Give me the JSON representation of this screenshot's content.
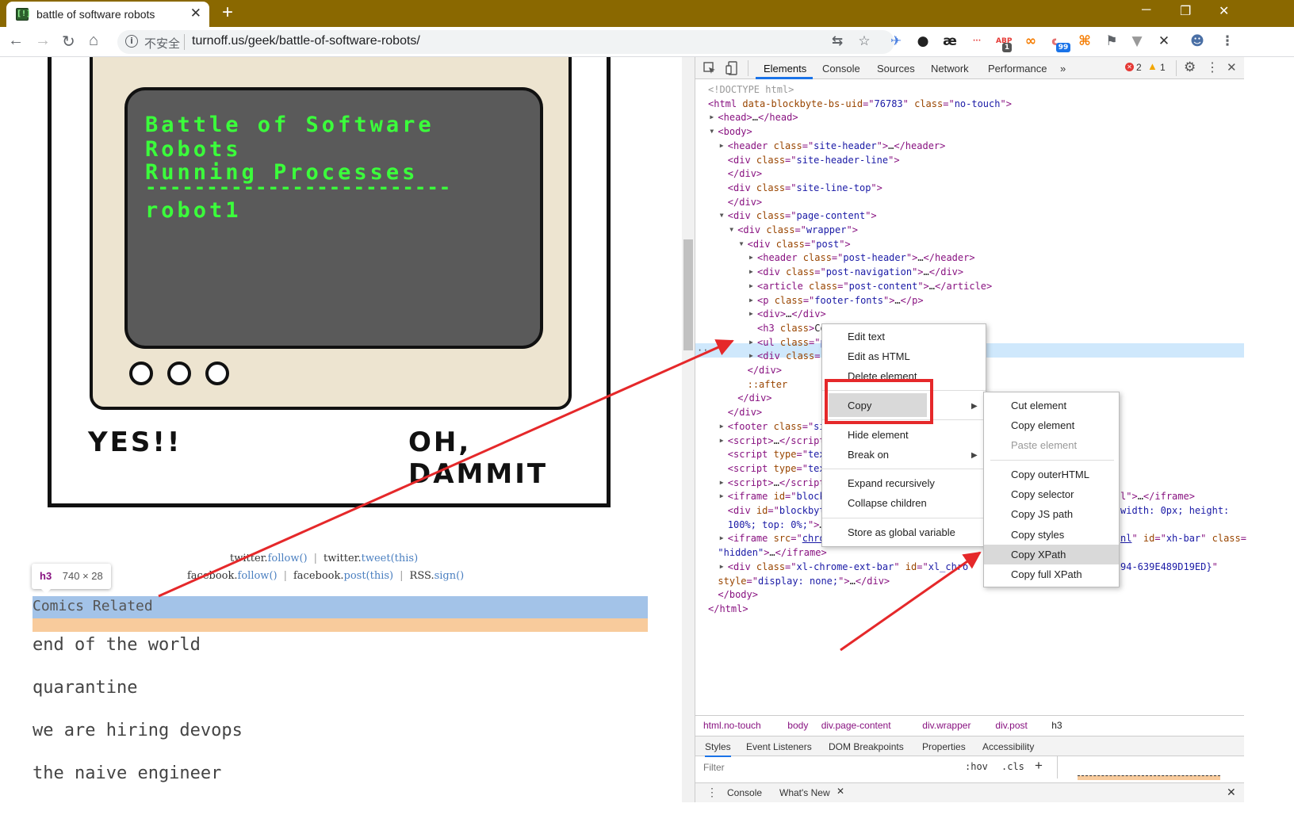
{
  "browser": {
    "tab_title": "battle of software robots",
    "tab_favicon": "[!]",
    "new_tab": "+",
    "minimize": "─",
    "restore": "❐",
    "close": "✕",
    "back": "←",
    "forward": "→",
    "reload": "↻",
    "home": "⌂",
    "info_icon": "i",
    "security_label": "不安全",
    "url": "turnoff.us/geek/battle-of-software-robots/",
    "extensions": [
      {
        "icon": "translate-icon",
        "glyph": "⇆",
        "color": "#5f6368"
      },
      {
        "icon": "star-icon",
        "glyph": "☆",
        "color": "#5f6368"
      },
      {
        "icon": "bird-extension-icon",
        "glyph": "✈",
        "color": "#4a7fe0"
      },
      {
        "icon": "octo-extension-icon",
        "glyph": "●",
        "color": "#222"
      },
      {
        "icon": "ae-extension-icon",
        "glyph": "æ",
        "color": "#222"
      },
      {
        "icon": "dots-extension-icon",
        "glyph": "···",
        "color": "#e53935"
      },
      {
        "icon": "abp-icon",
        "glyph": "ABP",
        "badge": "1",
        "color": "#e53935"
      },
      {
        "icon": "loop-extension-icon",
        "glyph": "∞",
        "color": "#f57c00"
      },
      {
        "icon": "cat-extension-icon",
        "glyph": "ᓚ",
        "badge": "99",
        "color": "#e57373"
      },
      {
        "icon": "tree-extension-icon",
        "glyph": "⌘",
        "color": "#f57c00"
      },
      {
        "icon": "bookmark-icon",
        "glyph": "⚑",
        "color": "#5f6368"
      },
      {
        "icon": "v-extension-icon",
        "glyph": "▼",
        "color": "#999"
      },
      {
        "icon": "x-extension-icon",
        "glyph": "✕",
        "color": "#333"
      },
      {
        "icon": "profile-avatar",
        "glyph": "☻",
        "color": "#4a6fa5"
      },
      {
        "icon": "menu-icon",
        "glyph": "⋮",
        "color": "#5f6368"
      }
    ]
  },
  "comic": {
    "screen_lines": [
      "Battle of Software Robots",
      "Running Processes",
      "-------------------------",
      "robot1"
    ],
    "left_shout": "YES!!",
    "right_shout": "OH, DAMMIT"
  },
  "social": {
    "row1": [
      {
        "prefix": "twitter.",
        "link": "follow()"
      },
      {
        "prefix": "twitter.",
        "link": "tweet(this)"
      }
    ],
    "row2": [
      {
        "prefix": "facebook.",
        "link": "follow()"
      },
      {
        "prefix": "facebook.",
        "link": "post(this)"
      },
      {
        "prefix": "RSS.",
        "link": "sign()"
      }
    ],
    "divider": "|"
  },
  "inspect_tip": {
    "tag": "h3",
    "dims": "740 × 28"
  },
  "page_list": {
    "heading": "Comics Related",
    "items": [
      "end of the world",
      "quarantine",
      "we are hiring devops",
      "the naive engineer"
    ]
  },
  "devtools": {
    "tabs": [
      "Elements",
      "Console",
      "Sources",
      "Network",
      "Performance",
      "»"
    ],
    "errors": "2",
    "warnings": "1",
    "dom_lines": [
      {
        "indent": 0,
        "parts": [
          [
            "cm",
            "<!DOCTYPE html>"
          ]
        ]
      },
      {
        "indent": 0,
        "parts": [
          [
            "tg",
            "<html "
          ],
          [
            "at",
            "data-blockbyte-bs-uid"
          ],
          [
            "tg",
            "=\""
          ],
          [
            "av",
            "76783"
          ],
          [
            "tg",
            "\" "
          ],
          [
            "at",
            "class"
          ],
          [
            "tg",
            "=\""
          ],
          [
            "av",
            "no-touch"
          ],
          [
            "tg",
            "\">"
          ]
        ]
      },
      {
        "indent": 1,
        "arrow": "▶",
        "parts": [
          [
            "tg",
            "<head>"
          ],
          [
            "tx",
            "…"
          ],
          [
            "tg",
            "</head>"
          ]
        ]
      },
      {
        "indent": 1,
        "arrow": "▼",
        "parts": [
          [
            "tg",
            "<body>"
          ]
        ]
      },
      {
        "indent": 2,
        "arrow": "▶",
        "parts": [
          [
            "tg",
            "<header "
          ],
          [
            "at",
            "class"
          ],
          [
            "tg",
            "=\""
          ],
          [
            "av",
            "site-header"
          ],
          [
            "tg",
            "\">"
          ],
          [
            "tx",
            "…"
          ],
          [
            "tg",
            "</header>"
          ]
        ]
      },
      {
        "indent": 2,
        "parts": [
          [
            "tg",
            "<div "
          ],
          [
            "at",
            "class"
          ],
          [
            "tg",
            "=\""
          ],
          [
            "av",
            "site-header-line"
          ],
          [
            "tg",
            "\">"
          ]
        ]
      },
      {
        "indent": 2,
        "parts": [
          [
            "tg",
            "</div>"
          ]
        ]
      },
      {
        "indent": 2,
        "parts": [
          [
            "tg",
            "<div "
          ],
          [
            "at",
            "class"
          ],
          [
            "tg",
            "=\""
          ],
          [
            "av",
            "site-line-top"
          ],
          [
            "tg",
            "\">"
          ]
        ]
      },
      {
        "indent": 2,
        "parts": [
          [
            "tg",
            "</div>"
          ]
        ]
      },
      {
        "indent": 2,
        "arrow": "▼",
        "parts": [
          [
            "tg",
            "<div "
          ],
          [
            "at",
            "class"
          ],
          [
            "tg",
            "=\""
          ],
          [
            "av",
            "page-content"
          ],
          [
            "tg",
            "\">"
          ]
        ]
      },
      {
        "indent": 3,
        "arrow": "▼",
        "parts": [
          [
            "tg",
            "<div "
          ],
          [
            "at",
            "class"
          ],
          [
            "tg",
            "=\""
          ],
          [
            "av",
            "wrapper"
          ],
          [
            "tg",
            "\">"
          ]
        ]
      },
      {
        "indent": 4,
        "arrow": "▼",
        "parts": [
          [
            "tg",
            "<div "
          ],
          [
            "at",
            "class"
          ],
          [
            "tg",
            "=\""
          ],
          [
            "av",
            "post"
          ],
          [
            "tg",
            "\">"
          ]
        ]
      },
      {
        "indent": 5,
        "arrow": "▶",
        "parts": [
          [
            "tg",
            "<header "
          ],
          [
            "at",
            "class"
          ],
          [
            "tg",
            "=\""
          ],
          [
            "av",
            "post-header"
          ],
          [
            "tg",
            "\">"
          ],
          [
            "tx",
            "…"
          ],
          [
            "tg",
            "</header>"
          ]
        ]
      },
      {
        "indent": 5,
        "arrow": "▶",
        "parts": [
          [
            "tg",
            "<div "
          ],
          [
            "at",
            "class"
          ],
          [
            "tg",
            "=\""
          ],
          [
            "av",
            "post-navigation"
          ],
          [
            "tg",
            "\">"
          ],
          [
            "tx",
            "…"
          ],
          [
            "tg",
            "</div>"
          ]
        ]
      },
      {
        "indent": 5,
        "arrow": "▶",
        "parts": [
          [
            "tg",
            "<article "
          ],
          [
            "at",
            "class"
          ],
          [
            "tg",
            "=\""
          ],
          [
            "av",
            "post-content"
          ],
          [
            "tg",
            "\">"
          ],
          [
            "tx",
            "…"
          ],
          [
            "tg",
            "</article>"
          ]
        ]
      },
      {
        "indent": 5,
        "arrow": "▶",
        "parts": [
          [
            "tg",
            "<p "
          ],
          [
            "at",
            "class"
          ],
          [
            "tg",
            "=\""
          ],
          [
            "av",
            "footer-fonts"
          ],
          [
            "tg",
            "\">"
          ],
          [
            "tx",
            "…"
          ],
          [
            "tg",
            "</p>"
          ]
        ]
      },
      {
        "indent": 5,
        "arrow": "▶",
        "parts": [
          [
            "tg",
            "<div>"
          ],
          [
            "tx",
            "…"
          ],
          [
            "tg",
            "</div>"
          ]
        ]
      },
      {
        "indent": 5,
        "parts": [
          [
            "tg",
            "<h3 "
          ],
          [
            "at",
            "class"
          ],
          [
            "tg",
            ">"
          ],
          [
            "tx",
            "Co"
          ]
        ]
      },
      {
        "indent": 5,
        "arrow": "▶",
        "parts": [
          [
            "tg",
            "<ul "
          ],
          [
            "at",
            "class"
          ],
          [
            "tg",
            "=\""
          ],
          [
            "av",
            "p"
          ]
        ]
      },
      {
        "indent": 5,
        "arrow": "▶",
        "parts": [
          [
            "tg",
            "<div "
          ],
          [
            "at",
            "class"
          ],
          [
            "tg",
            "=\""
          ]
        ]
      },
      {
        "indent": 4,
        "parts": [
          [
            "tg",
            "</div>"
          ]
        ]
      },
      {
        "indent": 4,
        "parts": [
          [
            "at",
            "::after"
          ]
        ]
      },
      {
        "indent": 3,
        "parts": [
          [
            "tg",
            "</div>"
          ]
        ]
      },
      {
        "indent": 2,
        "parts": [
          [
            "tg",
            "</div>"
          ]
        ]
      },
      {
        "indent": 2,
        "arrow": "▶",
        "parts": [
          [
            "tg",
            "<footer "
          ],
          [
            "at",
            "class"
          ],
          [
            "tg",
            "=\""
          ],
          [
            "av",
            "si"
          ]
        ]
      },
      {
        "indent": 2,
        "arrow": "▶",
        "parts": [
          [
            "tg",
            "<script>"
          ],
          [
            "tx",
            "…"
          ],
          [
            "tg",
            "</script"
          ]
        ]
      },
      {
        "indent": 2,
        "parts": [
          [
            "tg",
            "<script "
          ],
          [
            "at",
            "type"
          ],
          [
            "tg",
            "=\""
          ],
          [
            "av",
            "tex"
          ]
        ]
      },
      {
        "indent": 2,
        "parts": [
          [
            "tg",
            "<script "
          ],
          [
            "at",
            "type"
          ],
          [
            "tg",
            "=\""
          ],
          [
            "av",
            "tex"
          ]
        ]
      },
      {
        "indent": 2,
        "arrow": "▶",
        "parts": [
          [
            "tg",
            "<script>"
          ],
          [
            "tx",
            "…"
          ],
          [
            "tg",
            "</script"
          ]
        ]
      },
      {
        "indent": 2,
        "arrow": "▶",
        "parts": [
          [
            "tg",
            "<iframe "
          ],
          [
            "at",
            "id"
          ],
          [
            "tg",
            "=\""
          ],
          [
            "av",
            "block"
          ]
        ]
      },
      {
        "indent": 2,
        "parts": [
          [
            "tg",
            "<div "
          ],
          [
            "at",
            "id"
          ],
          [
            "tg",
            "=\""
          ],
          [
            "av",
            "blockbyt"
          ]
        ]
      },
      {
        "indent": 2,
        "parts": [
          [
            "av",
            "100%; top: 0%;"
          ],
          [
            "tg",
            "\">"
          ],
          [
            "tx",
            "…"
          ]
        ]
      },
      {
        "indent": 2,
        "arrow": "▶",
        "parts": [
          [
            "tg",
            "<iframe "
          ],
          [
            "at",
            "src"
          ],
          [
            "tg",
            "=\""
          ],
          [
            "lnk",
            "chro"
          ]
        ]
      },
      {
        "indent": 1,
        "parts": [
          [
            "av",
            "\"hidden\""
          ],
          [
            "tg",
            ">"
          ],
          [
            "tx",
            "…"
          ],
          [
            "tg",
            "</iframe>"
          ]
        ]
      },
      {
        "indent": 2,
        "arrow": "▶",
        "parts": [
          [
            "tg",
            "<div "
          ],
          [
            "at",
            "class"
          ],
          [
            "tg",
            "=\""
          ],
          [
            "av",
            "xl-chrome-ext-bar"
          ],
          [
            "tg",
            "\" "
          ],
          [
            "at",
            "id"
          ],
          [
            "tg",
            "=\""
          ],
          [
            "av",
            "xl_chro"
          ]
        ]
      },
      {
        "indent": 1,
        "parts": [
          [
            "at",
            "style"
          ],
          [
            "tg",
            "=\""
          ],
          [
            "av",
            "display: none;"
          ],
          [
            "tg",
            "\">"
          ],
          [
            "tx",
            "…"
          ],
          [
            "tg",
            "</div>"
          ]
        ]
      },
      {
        "indent": 1,
        "parts": [
          [
            "tg",
            "</body>"
          ]
        ]
      },
      {
        "indent": 0,
        "parts": [
          [
            "tg",
            "</html>"
          ]
        ]
      }
    ],
    "overflow_lines": [
      {
        "row": 29,
        "parts": [
          [
            "tg",
            "l\">"
          ],
          [
            "tx",
            "…"
          ],
          [
            "tg",
            "</iframe>"
          ]
        ]
      },
      {
        "row": 30,
        "parts": [
          [
            "av",
            "width: 0px; height:"
          ]
        ]
      },
      {
        "row": 32,
        "parts": [
          [
            "lnk",
            "nl"
          ],
          [
            "tg",
            "\" "
          ],
          [
            "at",
            "id"
          ],
          [
            "tg",
            "=\""
          ],
          [
            "av",
            "xh-bar"
          ],
          [
            "tg",
            "\" "
          ],
          [
            "at",
            "class"
          ],
          [
            "tg",
            "="
          ]
        ]
      },
      {
        "row": 34,
        "parts": [
          [
            "av",
            "94-639E489D19ED}"
          ],
          [
            "tg",
            "\""
          ]
        ]
      }
    ],
    "ellipsis": "···",
    "breadcrumbs": [
      "html.no-touch",
      "body",
      "div.page-content",
      "div.wrapper",
      "div.post",
      "h3"
    ],
    "style_tabs": [
      "Styles",
      "Event Listeners",
      "DOM Breakpoints",
      "Properties",
      "Accessibility"
    ],
    "filter_placeholder": "Filter",
    "hov": ":hov",
    "cls": ".cls",
    "plus": "+",
    "drawer_tabs": [
      "Console",
      "What's New"
    ],
    "drawer_close_tab": "✕",
    "close": "✕"
  },
  "context_menu": {
    "items": [
      "Edit text",
      "Edit as HTML",
      "Delete element",
      "Copy",
      "Hide element",
      "Break on",
      "Expand recursively",
      "Collapse children",
      "Store as global variable"
    ],
    "submenu_arrow": "▶"
  },
  "copy_submenu": {
    "items": [
      "Cut element",
      "Copy element",
      "Paste element",
      "Copy outerHTML",
      "Copy selector",
      "Copy JS path",
      "Copy styles",
      "Copy XPath",
      "Copy full XPath"
    ]
  },
  "colors": {
    "titlebar": "#8a6800",
    "annotation_red": "#e5282a",
    "selection_blue": "#cfe8fc",
    "highlight_blue": "#a3c3e8",
    "highlight_orange": "#f8cb9c"
  }
}
